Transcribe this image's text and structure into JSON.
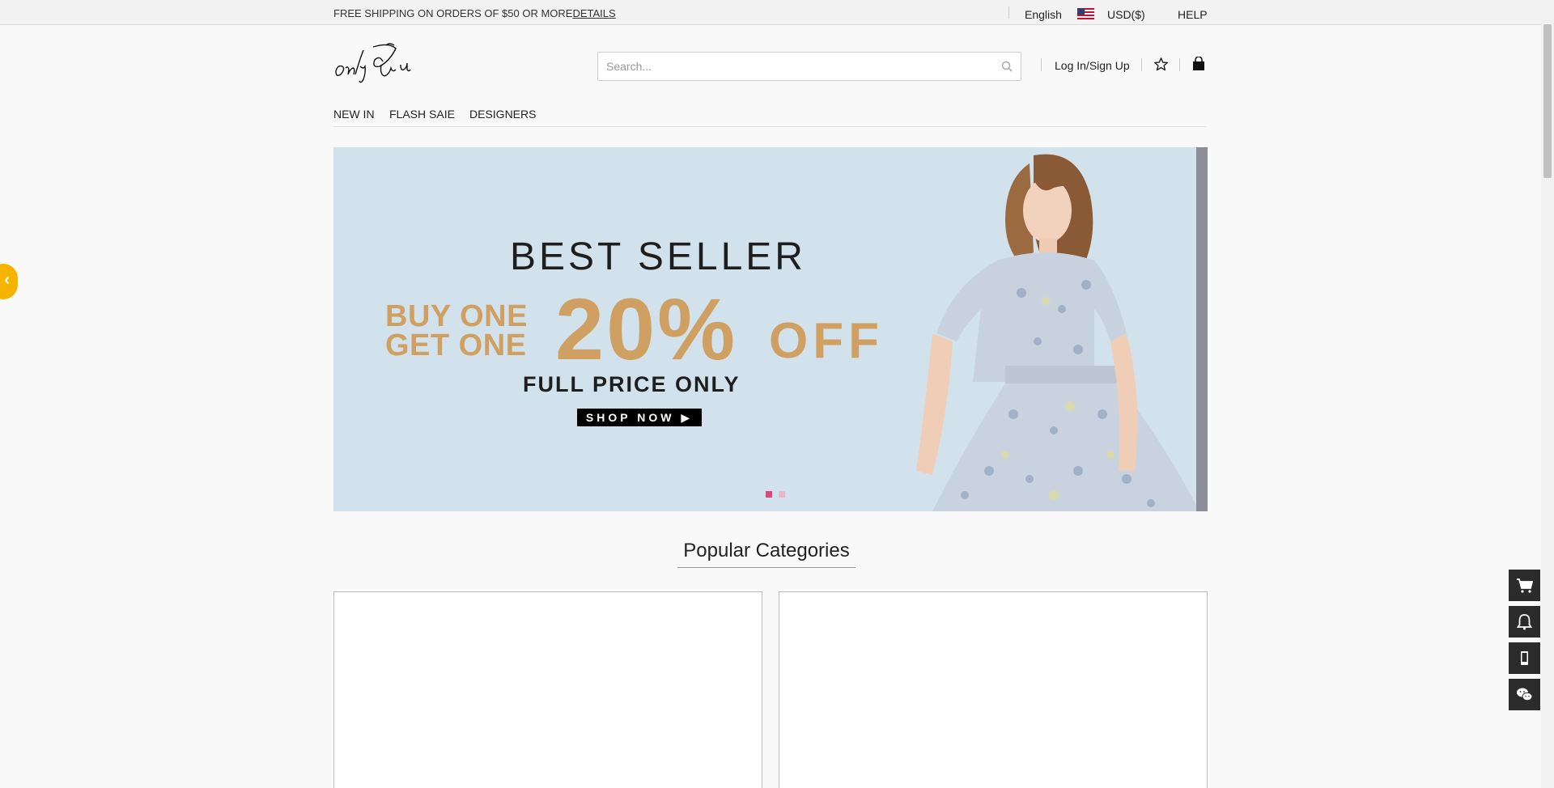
{
  "topbar": {
    "shipping": "FREE SHIPPING ON ORDERS OF $50 OR MORE",
    "details": "DETAILS",
    "language": "English",
    "currency": "USD($)",
    "help": "HELP"
  },
  "header": {
    "logo_alt": "only You",
    "search_placeholder": "Search...",
    "login": "Log In/Sign Up"
  },
  "nav": {
    "items": [
      "NEW IN",
      "FLASH SAIE",
      "DESIGNERS"
    ]
  },
  "banner": {
    "headline": "BEST SELLER",
    "promo_line1": "BUY ONE",
    "promo_line2": "GET ONE",
    "percent": "20%",
    "off": "OFF",
    "subline": "FULL PRICE ONLY",
    "cta": "SHOP NOW ▶",
    "slides": 2,
    "active_slide": 1
  },
  "sections": {
    "popular_title": "Popular Categories"
  },
  "colors": {
    "accent_gold": "#cfa061",
    "banner_bg": "#d2e2ec",
    "arrow": "#f5b400",
    "dot_active": "#e0457b",
    "dot_inactive": "#e8b7c9"
  },
  "floating_tools": [
    "cart-icon",
    "bell-icon",
    "mobile-icon",
    "wechat-icon"
  ]
}
